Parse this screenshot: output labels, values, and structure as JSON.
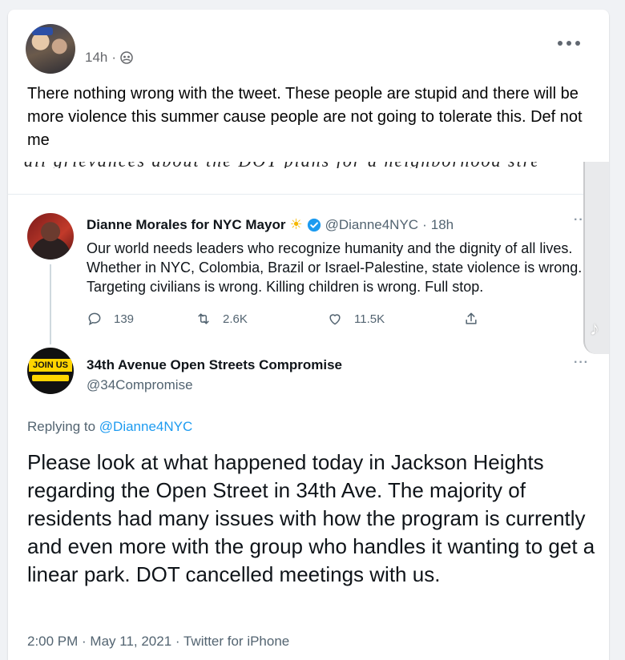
{
  "post": {
    "time": "14h",
    "separator": "·",
    "audience_icon": "friends-icon",
    "more_icon": "more-horizontal-icon",
    "text": "There nothing wrong with the tweet. These people are stupid and there will be more violence this summer cause people are not going to tolerate this. Def not me"
  },
  "screenshot": {
    "cutoff_text": "all grievances about the DOT plans for a neighborhood street.",
    "tweet1": {
      "name": "Dianne Morales for NYC Mayor",
      "name_emoji": "☀",
      "handle": "@Dianne4NYC",
      "separator": "·",
      "time": "18h",
      "body": "Our world needs leaders who recognize humanity and the dignity of all lives. Whether in NYC, Colombia, Brazil or Israel-Palestine, state violence is wrong. Targeting civilians is wrong. Killing children is wrong. Full stop.",
      "replies": "139",
      "retweets": "2.6K",
      "likes": "11.5K",
      "more": "··"
    },
    "tweet2": {
      "name": "34th Avenue Open Streets Compromise",
      "handle": "@34Compromise",
      "avatar_text": "JOIN US",
      "more": "···",
      "replying_prefix": "Replying to ",
      "replying_to": "@Dianne4NYC",
      "body": "Please look at what happened today in Jackson Heights regarding the Open Street in 34th Ave. The majority of residents had many issues with how the program is currently and even more with the group who handles it wanting to get a linear park. DOT cancelled meetings with us.",
      "timestamp": "2:00 PM · May 11, 2021 · Twitter for iPhone"
    }
  },
  "colors": {
    "facebook_bg": "#f0f2f5",
    "twitter_blue": "#1d9bf0",
    "muted_text": "#536471"
  }
}
